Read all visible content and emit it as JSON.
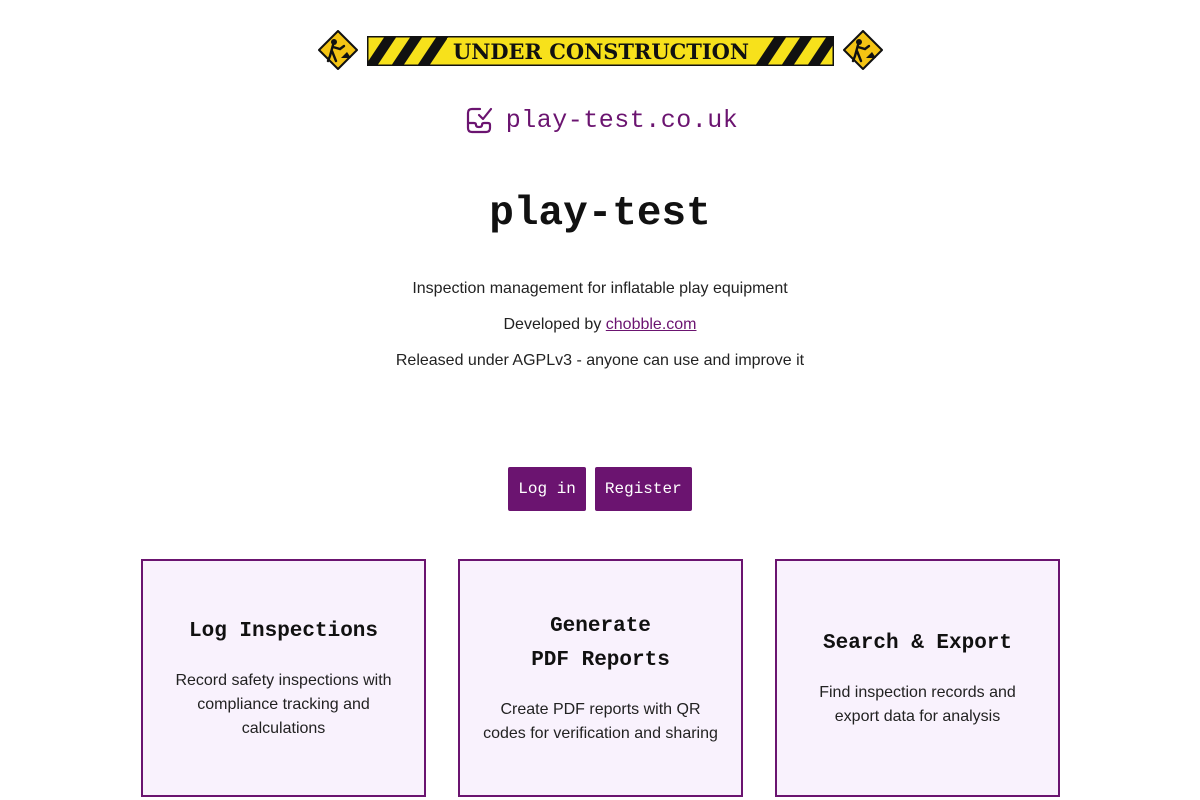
{
  "banner": {
    "text": "UNDER CONSTRUCTION",
    "colors": {
      "stripe_yellow": "#f7e11b",
      "stripe_black": "#111111",
      "sign_yellow": "#f4c414"
    },
    "icons": [
      "construction-worker-sign-icon",
      "construction-worker-sign-icon"
    ]
  },
  "header": {
    "logo_icon": "checkbox-tray-icon",
    "site_name": "play-test.co.uk"
  },
  "main": {
    "title": "play-test",
    "tagline": "Inspection management for inflatable play equipment",
    "developed_prefix": "Developed by ",
    "developer_link": "chobble.com",
    "license": "Released under AGPLv3 - anyone can use and improve it"
  },
  "auth": {
    "login_label": "Log in",
    "register_label": "Register"
  },
  "features": [
    {
      "title": "Log Inspections",
      "description": "Record safety inspections with compliance tracking and calculations"
    },
    {
      "title_line1": "Generate",
      "title_line2": "PDF Reports",
      "description": "Create PDF reports with QR codes for verification and sharing"
    },
    {
      "title": "Search & Export",
      "description": "Find inspection records and export data for analysis"
    }
  ],
  "theme": {
    "accent": "#6b1470",
    "card_background": "#f9f2fd"
  }
}
